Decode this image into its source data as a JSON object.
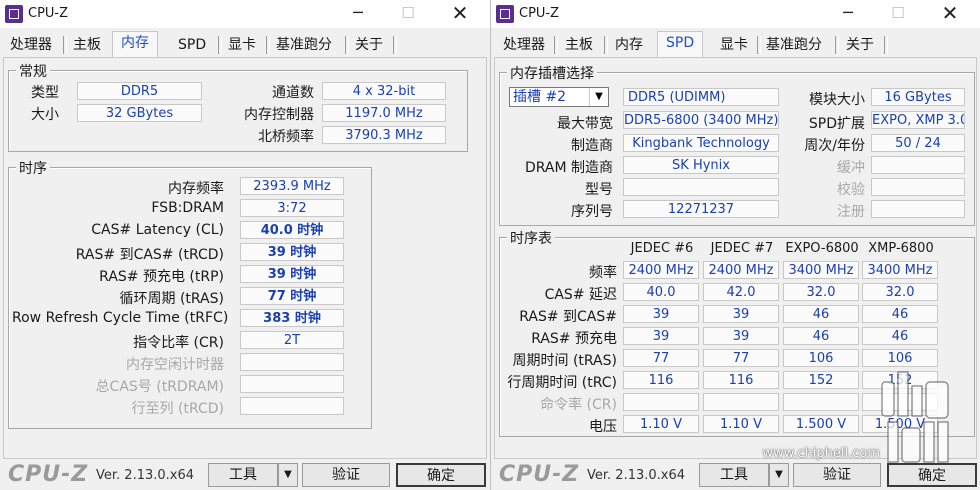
{
  "windows": [
    {
      "title": "CPU-Z",
      "tabs": [
        "处理器",
        "主板",
        "内存",
        "SPD",
        "显卡",
        "基准跑分",
        "关于"
      ],
      "active_tab": "内存",
      "general": {
        "group_label": "常规",
        "type_label": "类型",
        "type_value": "DDR5",
        "size_label": "大小",
        "size_value": "32 GBytes",
        "channels_label": "通道数",
        "channels_value": "4 x 32-bit",
        "controller_label": "内存控制器",
        "controller_value": "1197.0 MHz",
        "nb_label": "北桥频率",
        "nb_value": "3790.3 MHz"
      },
      "timings": {
        "group_label": "时序",
        "rows": [
          {
            "label": "内存频率",
            "value": "2393.9 MHz",
            "enabled": true
          },
          {
            "label": "FSB:DRAM",
            "value": "3:72",
            "enabled": true
          },
          {
            "label": "CAS# Latency (CL)",
            "value": "40.0 时钟",
            "enabled": true
          },
          {
            "label": "RAS# 到CAS# (tRCD)",
            "value": "39 时钟",
            "enabled": true
          },
          {
            "label": "RAS# 预充电 (tRP)",
            "value": "39 时钟",
            "enabled": true
          },
          {
            "label": "循环周期 (tRAS)",
            "value": "77 时钟",
            "enabled": true
          },
          {
            "label": "Row Refresh Cycle Time (tRFC)",
            "value": "383 时钟",
            "enabled": true
          },
          {
            "label": "指令比率 (CR)",
            "value": "2T",
            "enabled": true
          },
          {
            "label": "内存空闲计时器",
            "value": "",
            "enabled": false
          },
          {
            "label": "总CAS号 (tRDRAM)",
            "value": "",
            "enabled": false
          },
          {
            "label": "行至列 (tRCD)",
            "value": "",
            "enabled": false
          }
        ]
      },
      "footer": {
        "logo": "CPU-Z",
        "version": "Ver. 2.13.0.x64",
        "tools_label": "工具",
        "validate_label": "验证",
        "ok_label": "确定"
      }
    },
    {
      "title": "CPU-Z",
      "tabs": [
        "处理器",
        "主板",
        "内存",
        "SPD",
        "显卡",
        "基准跑分",
        "关于"
      ],
      "active_tab": "SPD",
      "slot": {
        "group_label": "内存插槽选择",
        "selected": "插槽 #2",
        "type_value": "DDR5 (UDIMM)",
        "max_bw_label": "最大带宽",
        "max_bw_value": "DDR5-6800 (3400 MHz)",
        "manufacturer_label": "制造商",
        "manufacturer_value": "Kingbank Technology",
        "dram_mfr_label": "DRAM 制造商",
        "dram_mfr_value": "SK Hynix",
        "part_label": "型号",
        "part_value": "",
        "serial_label": "序列号",
        "serial_value": "12271237",
        "module_size_label": "模块大小",
        "module_size_value": "16 GBytes",
        "spd_ext_label": "SPD扩展",
        "spd_ext_value": "EXPO, XMP 3.0",
        "week_year_label": "周次/年份",
        "week_year_value": "50 / 24",
        "buffer_label": "缓冲",
        "check_label": "校验",
        "reg_label": "注册"
      },
      "timing_table": {
        "group_label": "时序表",
        "columns": [
          "JEDEC #6",
          "JEDEC #7",
          "EXPO-6800",
          "XMP-6800"
        ],
        "rows": [
          {
            "label": "频率",
            "values": [
              "2400 MHz",
              "2400 MHz",
              "3400 MHz",
              "3400 MHz"
            ],
            "enabled": true
          },
          {
            "label": "CAS# 延迟",
            "values": [
              "40.0",
              "42.0",
              "32.0",
              "32.0"
            ],
            "enabled": true
          },
          {
            "label": "RAS# 到CAS#",
            "values": [
              "39",
              "39",
              "46",
              "46"
            ],
            "enabled": true
          },
          {
            "label": "RAS# 预充电",
            "values": [
              "39",
              "39",
              "46",
              "46"
            ],
            "enabled": true
          },
          {
            "label": "周期时间 (tRAS)",
            "values": [
              "77",
              "77",
              "106",
              "106"
            ],
            "enabled": true
          },
          {
            "label": "行周期时间 (tRC)",
            "values": [
              "116",
              "116",
              "152",
              "152"
            ],
            "enabled": true
          },
          {
            "label": "命令率 (CR)",
            "values": [
              "",
              "",
              "",
              ""
            ],
            "enabled": false
          },
          {
            "label": "电压",
            "values": [
              "1.10 V",
              "1.10 V",
              "1.500 V",
              "1.500 V"
            ],
            "enabled": true
          }
        ]
      },
      "footer": {
        "logo": "CPU-Z",
        "version": "Ver. 2.13.0.x64",
        "tools_label": "工具",
        "validate_label": "验证",
        "ok_label": "确定"
      }
    }
  ],
  "watermark": {
    "url": "www.chiphell.com",
    "logo_text": "chip hell"
  }
}
